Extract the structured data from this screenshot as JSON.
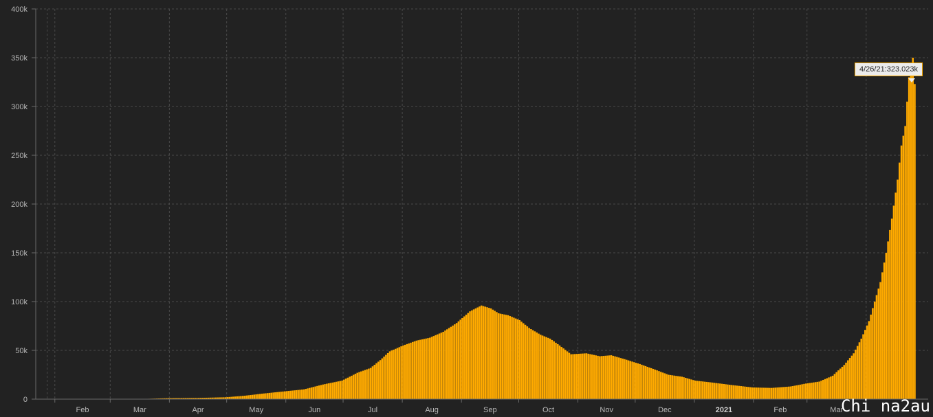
{
  "chart_data": {
    "type": "bar",
    "title": "",
    "xlabel": "",
    "ylabel": "",
    "ylim": [
      0,
      400000
    ],
    "y_ticks": [
      "0",
      "50k",
      "100k",
      "150k",
      "200k",
      "250k",
      "300k",
      "350k",
      "400k"
    ],
    "x_ticks": [
      "Feb",
      "Mar",
      "Apr",
      "May",
      "Jun",
      "Jul",
      "Aug",
      "Sep",
      "Oct",
      "Nov",
      "Dec",
      "2021",
      "Feb",
      "Mar"
    ],
    "grid": true,
    "bar_color": "#ffaa00",
    "x_start": "2020-01-22",
    "x_end": "2021-04-26",
    "points": [
      [
        "2020-01-22",
        0
      ],
      [
        "2020-02-29",
        0
      ],
      [
        "2020-03-15",
        30
      ],
      [
        "2020-03-31",
        1000
      ],
      [
        "2020-04-15",
        1200
      ],
      [
        "2020-04-30",
        1900
      ],
      [
        "2020-05-10",
        3500
      ],
      [
        "2020-05-20",
        5800
      ],
      [
        "2020-05-31",
        8000
      ],
      [
        "2020-06-10",
        10000
      ],
      [
        "2020-06-20",
        15000
      ],
      [
        "2020-06-30",
        19000
      ],
      [
        "2020-07-08",
        27000
      ],
      [
        "2020-07-15",
        32000
      ],
      [
        "2020-07-20",
        40000
      ],
      [
        "2020-07-25",
        49000
      ],
      [
        "2020-08-01",
        55000
      ],
      [
        "2020-08-08",
        60000
      ],
      [
        "2020-08-15",
        63000
      ],
      [
        "2020-08-22",
        69000
      ],
      [
        "2020-08-29",
        78000
      ],
      [
        "2020-09-05",
        90000
      ],
      [
        "2020-09-11",
        96000
      ],
      [
        "2020-09-16",
        93000
      ],
      [
        "2020-09-20",
        88000
      ],
      [
        "2020-09-25",
        86000
      ],
      [
        "2020-10-01",
        81000
      ],
      [
        "2020-10-06",
        73000
      ],
      [
        "2020-10-12",
        66000
      ],
      [
        "2020-10-17",
        62000
      ],
      [
        "2020-10-22",
        55000
      ],
      [
        "2020-10-28",
        46000
      ],
      [
        "2020-11-05",
        47000
      ],
      [
        "2020-11-12",
        44000
      ],
      [
        "2020-11-18",
        45000
      ],
      [
        "2020-11-25",
        41000
      ],
      [
        "2020-12-03",
        36000
      ],
      [
        "2020-12-10",
        31000
      ],
      [
        "2020-12-18",
        25000
      ],
      [
        "2020-12-25",
        23000
      ],
      [
        "2021-01-01",
        19000
      ],
      [
        "2021-01-10",
        17000
      ],
      [
        "2021-01-20",
        14500
      ],
      [
        "2021-01-31",
        12000
      ],
      [
        "2021-02-10",
        11500
      ],
      [
        "2021-02-20",
        13000
      ],
      [
        "2021-02-28",
        16000
      ],
      [
        "2021-03-07",
        18000
      ],
      [
        "2021-03-14",
        24000
      ],
      [
        "2021-03-20",
        35000
      ],
      [
        "2021-03-25",
        47000
      ],
      [
        "2021-03-29",
        62000
      ],
      [
        "2021-04-02",
        80000
      ],
      [
        "2021-04-05",
        100000
      ],
      [
        "2021-04-08",
        120000
      ],
      [
        "2021-04-11",
        150000
      ],
      [
        "2021-04-14",
        185000
      ],
      [
        "2021-04-17",
        225000
      ],
      [
        "2021-04-19",
        260000
      ],
      [
        "2021-04-21",
        280000
      ],
      [
        "2021-04-23",
        330000
      ],
      [
        "2021-04-24",
        345000
      ],
      [
        "2021-04-25",
        350000
      ],
      [
        "2021-04-26",
        323023
      ]
    ]
  },
  "tooltip": {
    "text": "4/26/21:323.023k"
  },
  "watermark": {
    "text": "Chi na2au"
  }
}
